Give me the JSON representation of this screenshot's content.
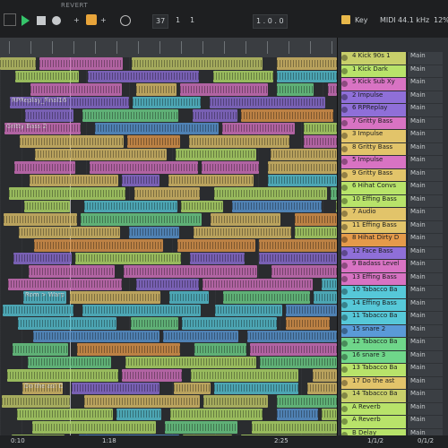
{
  "transport": {
    "revert": "REVERT",
    "tempo": "37",
    "sig_a": "1",
    "sig_b": "1",
    "pos": "1 . 0 . 0",
    "key": "Key",
    "midi": "MIDI",
    "rate": "44.1 kHz",
    "cpu": "12%"
  },
  "colors": {
    "pink": "#d873c3",
    "purple": "#8f6fd8",
    "yellow": "#e2c46a",
    "lime": "#b8e36a",
    "cyan": "#56c8d8",
    "blue": "#5a9ad8",
    "green": "#6fd68a",
    "orange": "#e59a4a"
  },
  "tracks": [
    {
      "label": "4 Kick 90s 1",
      "out": "Main",
      "color": "#c8cf6a"
    },
    {
      "label": "1 Kick Dark",
      "out": "Main",
      "color": "#b8e36a"
    },
    {
      "label": "5 Kick Sub Xy",
      "out": "Main",
      "color": "#d873c3"
    },
    {
      "label": "2 Impulse",
      "out": "Main",
      "color": "#8f6fd8"
    },
    {
      "label": "6 RPReplay",
      "out": "Main",
      "color": "#8f6fd8"
    },
    {
      "label": "7 Gritty Bass",
      "out": "Main",
      "color": "#d873c3"
    },
    {
      "label": "3 Impulse",
      "out": "Main",
      "color": "#e2c46a"
    },
    {
      "label": "8 Gritty Bass",
      "out": "Main",
      "color": "#e2c46a"
    },
    {
      "label": "5 Impulse",
      "out": "Main",
      "color": "#d873c3"
    },
    {
      "label": "9 Gritty Bass",
      "out": "Main",
      "color": "#e2c46a"
    },
    {
      "label": "6 Hihat Convs",
      "out": "Main",
      "color": "#b8e36a"
    },
    {
      "label": "10 Effing Bass",
      "out": "Main",
      "color": "#b8e36a"
    },
    {
      "label": "7 Audio",
      "out": "Main",
      "color": "#e2c46a"
    },
    {
      "label": "11 Effing Bass",
      "out": "Main",
      "color": "#e2c46a"
    },
    {
      "label": "8 Hihat Dirty D",
      "out": "Main",
      "color": "#e59a4a"
    },
    {
      "label": "12 Face Bass",
      "out": "Main",
      "color": "#8f6fd8"
    },
    {
      "label": "9 Badass Level",
      "out": "Main",
      "color": "#d873c3"
    },
    {
      "label": "13 Effing Bass",
      "out": "Main",
      "color": "#d873c3"
    },
    {
      "label": "10 Tabacco Ba",
      "out": "Main",
      "color": "#56c8d8"
    },
    {
      "label": "14 Effing Bass",
      "out": "Main",
      "color": "#56c8d8"
    },
    {
      "label": "11 Tabacco Ba",
      "out": "Main",
      "color": "#56c8d8"
    },
    {
      "label": "15 snare 2",
      "out": "Main",
      "color": "#5a9ad8"
    },
    {
      "label": "12 Tabacco Ba",
      "out": "Main",
      "color": "#6fd68a"
    },
    {
      "label": "16 snare 3",
      "out": "Main",
      "color": "#6fd68a"
    },
    {
      "label": "13 Tabacco Ba",
      "out": "Main",
      "color": "#b8e36a"
    },
    {
      "label": "17 Do the ast",
      "out": "Main",
      "color": "#e2c46a"
    },
    {
      "label": "14 Tabacco Ba",
      "out": "Main",
      "color": "#c8cf6a"
    },
    {
      "label": "A Reverb",
      "out": "Main",
      "color": "#b8e36a"
    },
    {
      "label": "A Reverb",
      "out": "Main",
      "color": "#b8e36a"
    },
    {
      "label": "B Delay",
      "out": "Main",
      "color": "#b8e36a"
    }
  ],
  "clip_texts": {
    "gritty": "Gritty Bass 2",
    "rpreplay": "RPReplay_Final16",
    "doast": "Do the as! Do the as! Do the as!",
    "rom": "Rom > Warp Hihat in Rom > Warp Hihat"
  },
  "footer": {
    "pos1": "0:10",
    "pos2": "1:18",
    "pos3": "2:25",
    "pos4": "1/1/2",
    "ratio": "0/1/2"
  }
}
